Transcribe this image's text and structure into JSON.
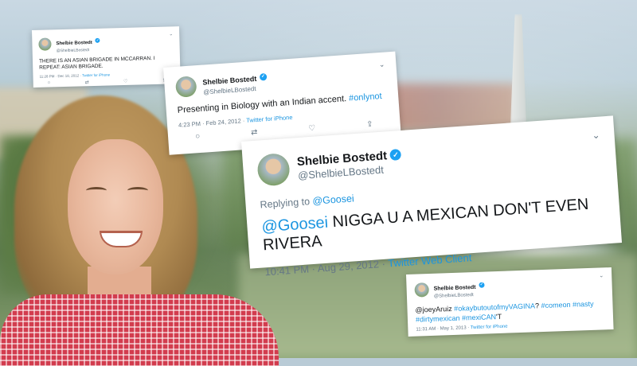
{
  "tweets": [
    {
      "name": "Shelbie Bostedt",
      "handle": "@ShelbieLBostedt",
      "text": "THERE IS AN ASIAN BRIGADE IN MCCARRAN. I REPEAT: ASIAN BRIGADE.",
      "time": "11:28 PM · Dec 18, 2012 · ",
      "source": "Twitter for iPhone"
    },
    {
      "name": "Shelbie Bostedt",
      "handle": "@ShelbieLBostedt",
      "text": "Presenting in Biology with an Indian accent. ",
      "hashtag": "#onlynot",
      "time": "4:23 PM · Feb 24, 2012 · ",
      "source": "Twitter for iPhone"
    },
    {
      "name": "Shelbie Bostedt",
      "handle": "@ShelbieLBostedt",
      "reply_prefix": "Replying to ",
      "reply_to": "@Goosei",
      "mention": "@Goosei",
      "text": " NIGGA U A MEXICAN DON'T EVEN RIVERA",
      "time": "10:41 PM · Aug 29, 2012 · ",
      "source": "Twitter Web Client"
    },
    {
      "name": "Shelbie Bostedt",
      "handle": "@ShelbieLBostedt",
      "mention": "@joeyAruiz",
      "hashtag1": "#okaybutoutofmyVAGINA",
      "mid1": "? ",
      "hashtag2": "#comeon",
      "hashtag3": "#nasty",
      "hashtag4": "#dirtymexican",
      "hashtag5": "#mexiCAN",
      "tail": "'T",
      "time": "11:31 AM · May 1, 2013 · ",
      "source": "Twitter for iPhone"
    }
  ],
  "icons": {
    "reply": "○",
    "retweet": "⇄",
    "like": "♡",
    "share": "⇪",
    "chevron": "⌄",
    "verified": "✓"
  },
  "colors": {
    "twitter_blue": "#1da1f2",
    "link_blue": "#1b95e0",
    "meta_gray": "#657786"
  }
}
